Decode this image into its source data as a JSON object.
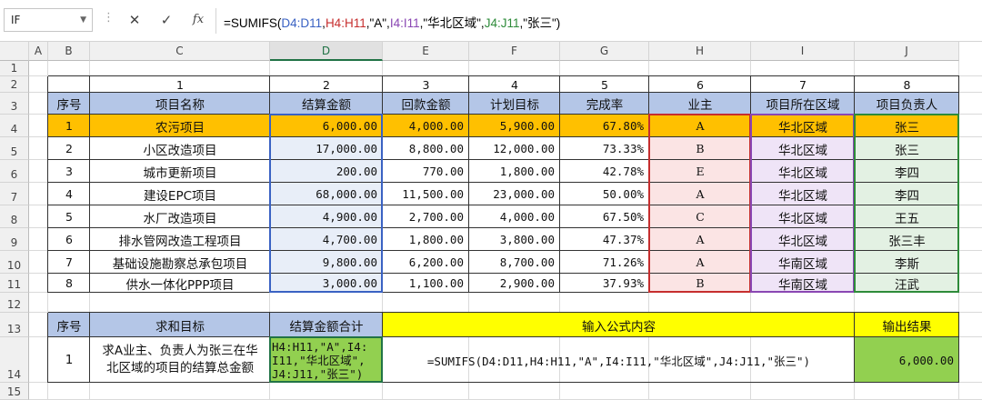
{
  "formula_bar": {
    "name_box": "IF",
    "dots": "⋮",
    "cancel_icon": "✕",
    "enter_icon": "✓",
    "fx_icon": "fx",
    "formula_parts": [
      {
        "t": "=SUMIFS(",
        "c": ""
      },
      {
        "t": "D4:D11",
        "c": "c-d"
      },
      {
        "t": ",",
        "c": ""
      },
      {
        "t": "H4:H11",
        "c": "c-h"
      },
      {
        "t": ",\"A\",",
        "c": ""
      },
      {
        "t": "I4:I11",
        "c": "c-i"
      },
      {
        "t": ",\"华北区域\",",
        "c": ""
      },
      {
        "t": "J4:J11",
        "c": "c-j"
      },
      {
        "t": ",\"张三\")",
        "c": ""
      }
    ]
  },
  "columns": [
    "A",
    "B",
    "C",
    "D",
    "E",
    "F",
    "G",
    "H",
    "I",
    "J"
  ],
  "rows": [
    "1",
    "2",
    "3",
    "4",
    "5",
    "6",
    "7",
    "8",
    "9",
    "10",
    "11",
    "12",
    "13",
    "14",
    "15"
  ],
  "index_row": [
    "1",
    "2",
    "3",
    "4",
    "5",
    "6",
    "7",
    "8"
  ],
  "headers": [
    "序号",
    "项目名称",
    "结算金额",
    "回款金额",
    "计划目标",
    "完成率",
    "业主",
    "项目所在区域",
    "项目负责人"
  ],
  "records": [
    [
      "1",
      "农污项目",
      "6,000.00",
      "4,000.00",
      "5,900.00",
      "67.80%",
      "A",
      "华北区域",
      "张三"
    ],
    [
      "2",
      "小区改造项目",
      "17,000.00",
      "8,800.00",
      "12,000.00",
      "73.33%",
      "B",
      "华北区域",
      "张三"
    ],
    [
      "3",
      "城市更新项目",
      "200.00",
      "770.00",
      "1,800.00",
      "42.78%",
      "E",
      "华北区域",
      "李四"
    ],
    [
      "4",
      "建设EPC项目",
      "68,000.00",
      "11,500.00",
      "23,000.00",
      "50.00%",
      "A",
      "华北区域",
      "李四"
    ],
    [
      "5",
      "水厂改造项目",
      "4,900.00",
      "2,700.00",
      "4,000.00",
      "67.50%",
      "C",
      "华北区域",
      "王五"
    ],
    [
      "6",
      "排水管网改造工程项目",
      "4,700.00",
      "1,800.00",
      "3,800.00",
      "47.37%",
      "A",
      "华北区域",
      "张三丰"
    ],
    [
      "7",
      "基础设施勘察总承包项目",
      "9,800.00",
      "6,200.00",
      "8,700.00",
      "71.26%",
      "A",
      "华南区域",
      "李斯"
    ],
    [
      "8",
      "供水一体化PPP项目",
      "3,000.00",
      "1,100.00",
      "2,900.00",
      "37.93%",
      "B",
      "华南区域",
      "汪武"
    ]
  ],
  "summary": {
    "h_no": "序号",
    "h_goal": "求和目标",
    "h_total": "结算金额合计",
    "h_formula": "输入公式内容",
    "h_result": "输出结果",
    "no": "1",
    "goal_line1": "求A业主、负责人为张三在华",
    "goal_line2": "北区域的项目的结算总金额",
    "edit_lines": [
      "H4:H11,\"A\",I4:",
      "I11,\"华北区域\",",
      "J4:J11,\"张三\")"
    ],
    "formula_text": "=SUMIFS(D4:D11,H4:H11,\"A\",I4:I11,\"华北区域\",J4:J11,\"张三\")",
    "result": "6,000.00"
  },
  "colors": {
    "header_blue": "#b4c6e7",
    "row_highlight": "#ffc000",
    "yellow": "#ffff00",
    "green_result": "#92d050",
    "ref_blue": "#3a62c3",
    "ref_red": "#c62e2e",
    "ref_purple": "#8a47b3",
    "ref_green": "#2e8b3a"
  }
}
